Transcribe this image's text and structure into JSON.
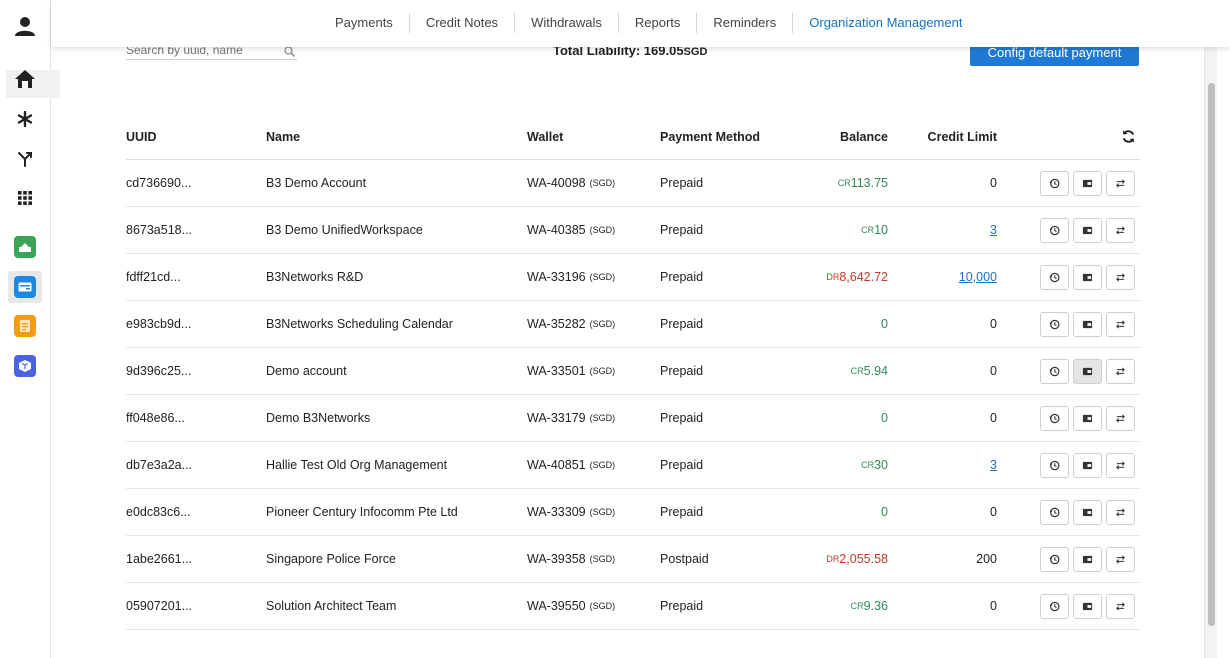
{
  "nav": {
    "tabs": [
      "Payments",
      "Credit Notes",
      "Withdrawals",
      "Reports",
      "Reminders",
      "Organization Management"
    ],
    "active_tab": "Organization Management"
  },
  "sidebar": {
    "icons": [
      "user-icon",
      "home-icon",
      "asterisk-icon",
      "fork-icon",
      "apps-grid-icon",
      "green-app-icon",
      "blue-card-app-icon",
      "orange-notes-app-icon",
      "blue-box-app-icon"
    ],
    "selected": "blue-card-app-icon"
  },
  "toolbar": {
    "search_placeholder": "Search by uuid, name",
    "liability_label": "Total Liability:",
    "liability_value": "169.05",
    "liability_currency": "SGD",
    "config_button": "Config default payment"
  },
  "table": {
    "columns": [
      "UUID",
      "Name",
      "Wallet",
      "Payment Method",
      "Balance",
      "Credit Limit"
    ],
    "rows": [
      {
        "uuid": "cd736690...",
        "name": "B3 Demo Account",
        "wallet": "WA-40098",
        "currency": "(SGD)",
        "method": "Prepaid",
        "balance_prefix": "CR",
        "balance": "113.75",
        "balance_type": "cr",
        "credit_limit": "0",
        "credit_link": false
      },
      {
        "uuid": "8673a518...",
        "name": "B3 Demo UnifiedWorkspace",
        "wallet": "WA-40385",
        "currency": "(SGD)",
        "method": "Prepaid",
        "balance_prefix": "CR",
        "balance": "10",
        "balance_type": "cr",
        "credit_limit": "3",
        "credit_link": true
      },
      {
        "uuid": "fdff21cd...",
        "name": "B3Networks R&D",
        "wallet": "WA-33196",
        "currency": "(SGD)",
        "method": "Prepaid",
        "balance_prefix": "DR",
        "balance": "8,642.72",
        "balance_type": "dr",
        "credit_limit": "10,000",
        "credit_link": true
      },
      {
        "uuid": "e983cb9d...",
        "name": "B3Networks Scheduling Calendar",
        "wallet": "WA-35282",
        "currency": "(SGD)",
        "method": "Prepaid",
        "balance_prefix": "",
        "balance": "0",
        "balance_type": "zero",
        "credit_limit": "0",
        "credit_link": false
      },
      {
        "uuid": "9d396c25...",
        "name": "Demo account",
        "wallet": "WA-33501",
        "currency": "(SGD)",
        "method": "Prepaid",
        "balance_prefix": "CR",
        "balance": "5.94",
        "balance_type": "cr",
        "credit_limit": "0",
        "credit_link": false
      },
      {
        "uuid": "ff048e86...",
        "name": "Demo B3Networks",
        "wallet": "WA-33179",
        "currency": "(SGD)",
        "method": "Prepaid",
        "balance_prefix": "",
        "balance": "0",
        "balance_type": "zero",
        "credit_limit": "0",
        "credit_link": false
      },
      {
        "uuid": "db7e3a2a...",
        "name": "Hallie Test Old Org Management",
        "wallet": "WA-40851",
        "currency": "(SGD)",
        "method": "Prepaid",
        "balance_prefix": "CR",
        "balance": "30",
        "balance_type": "cr",
        "credit_limit": "3",
        "credit_link": true
      },
      {
        "uuid": "e0dc83c6...",
        "name": "Pioneer Century Infocomm Pte Ltd",
        "wallet": "WA-33309",
        "currency": "(SGD)",
        "method": "Prepaid",
        "balance_prefix": "",
        "balance": "0",
        "balance_type": "zero",
        "credit_limit": "0",
        "credit_link": false
      },
      {
        "uuid": "1abe2661...",
        "name": "Singapore Police Force",
        "wallet": "WA-39358",
        "currency": "(SGD)",
        "method": "Postpaid",
        "balance_prefix": "DR",
        "balance": "2,055.58",
        "balance_type": "dr",
        "credit_limit": "200",
        "credit_link": false
      },
      {
        "uuid": "05907201...",
        "name": "Solution Architect Team",
        "wallet": "WA-39550",
        "currency": "(SGD)",
        "method": "Prepaid",
        "balance_prefix": "CR",
        "balance": "9.36",
        "balance_type": "cr",
        "credit_limit": "0",
        "credit_link": false
      }
    ],
    "row_actions": [
      "history-icon",
      "wallet-icon",
      "transfer-icon"
    ],
    "pressed_action_row": 4,
    "pressed_action": "wallet-icon"
  },
  "colors": {
    "accent": "#1f7ad6",
    "active_tab": "#1574c4",
    "credit": "#2e8b57",
    "debit": "#c0392b"
  }
}
